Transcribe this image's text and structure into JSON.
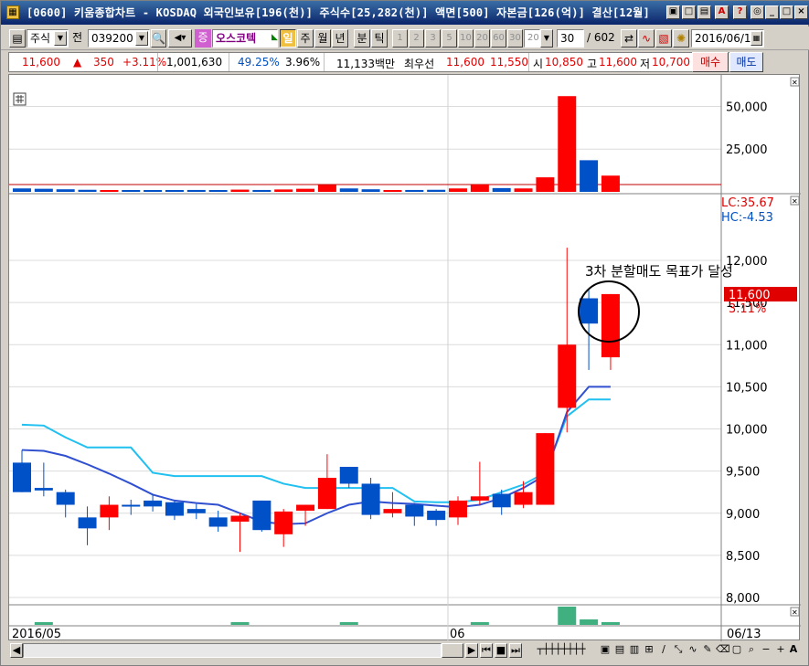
{
  "window": {
    "title": "[0600] 키움종합차트 - KOSDAQ 외국인보유[196(천)] 주식수[25,282(천)] 액면[500] 자본금[126(억)] 결산[12월]",
    "title_buttons": [
      "restore-small",
      "window",
      "tile",
      "print",
      "alert",
      "help",
      "find",
      "min",
      "max",
      "close"
    ]
  },
  "toolbar": {
    "market_type": "주식",
    "all_label": "전",
    "code": "039200",
    "stock_name": "오스코텍",
    "market_badge": "증",
    "periods": [
      "일",
      "주",
      "월",
      "년",
      "분",
      "틱"
    ],
    "active_period": "일",
    "intervals": [
      "1",
      "2",
      "3",
      "5",
      "10",
      "20",
      "60",
      "30",
      "20"
    ],
    "count": "30",
    "total": "/ 602",
    "date": "2016/06/1"
  },
  "quote": {
    "price": "11,600",
    "arrow": "▲",
    "change": "350",
    "change_pct": "+3.11%",
    "volume": "1,001,630",
    "vol_ratio": "49.25%",
    "turnover": "3.96%",
    "amount": "11,133백만",
    "best_label": "최우선",
    "best_ask": "11,600",
    "best_bid": "11,550",
    "open_label": "시",
    "open": "10,850",
    "high_label": "고",
    "high": "11,600",
    "low_label": "저",
    "low": "10,700",
    "buy": "매수",
    "sell": "매도"
  },
  "chart": {
    "volume_axis": [
      "50,000",
      "25,000"
    ],
    "price_axis": [
      "12,000",
      "11,500",
      "11,000",
      "10,500",
      "10,000",
      "9,500",
      "9,000",
      "8,500",
      "8,000"
    ],
    "lc_label": "LC:35.67",
    "hc_label": "HC:-4.53",
    "last_price_tag": "11,600",
    "last_pct_tag": "3.11%",
    "annotation": "3차 분할매도 목표가 달성",
    "x_labels": [
      "2016/05",
      "06"
    ],
    "end_date_label": "06/13"
  },
  "chart_data": {
    "type": "candlestick",
    "series_colors": {
      "up": "#ff0000",
      "down": "#0050c8",
      "ma_short": "#3050d0",
      "ma_long": "#20c0f0"
    },
    "ylim": [
      7950,
      12300
    ],
    "candles": [
      {
        "o": 9600,
        "h": 9750,
        "l": 9250,
        "c": 9250
      },
      {
        "o": 9300,
        "h": 9600,
        "l": 9200,
        "c": 9270
      },
      {
        "o": 9250,
        "h": 9280,
        "l": 8950,
        "c": 9100
      },
      {
        "o": 8950,
        "h": 9080,
        "l": 8620,
        "c": 8820
      },
      {
        "o": 8950,
        "h": 9200,
        "l": 8800,
        "c": 9100
      },
      {
        "o": 9100,
        "h": 9160,
        "l": 8980,
        "c": 9090
      },
      {
        "o": 9150,
        "h": 9220,
        "l": 9020,
        "c": 9080
      },
      {
        "o": 9130,
        "h": 9150,
        "l": 8920,
        "c": 8970
      },
      {
        "o": 9050,
        "h": 9110,
        "l": 8930,
        "c": 9000
      },
      {
        "o": 8950,
        "h": 9030,
        "l": 8780,
        "c": 8840
      },
      {
        "o": 8900,
        "h": 9000,
        "l": 8540,
        "c": 8970
      },
      {
        "o": 9150,
        "h": 9150,
        "l": 8780,
        "c": 8800
      },
      {
        "o": 8750,
        "h": 9050,
        "l": 8600,
        "c": 9020
      },
      {
        "o": 9030,
        "h": 9100,
        "l": 8850,
        "c": 9100
      },
      {
        "o": 9050,
        "h": 9700,
        "l": 9050,
        "c": 9420
      },
      {
        "o": 9550,
        "h": 9550,
        "l": 9300,
        "c": 9350
      },
      {
        "o": 9350,
        "h": 9420,
        "l": 8930,
        "c": 8980
      },
      {
        "o": 9000,
        "h": 9250,
        "l": 8950,
        "c": 9050
      },
      {
        "o": 9100,
        "h": 9120,
        "l": 8850,
        "c": 8960
      },
      {
        "o": 9030,
        "h": 9050,
        "l": 8850,
        "c": 8920
      },
      {
        "o": 8950,
        "h": 9200,
        "l": 8860,
        "c": 9150
      },
      {
        "o": 9150,
        "h": 9610,
        "l": 9100,
        "c": 9200
      },
      {
        "o": 9230,
        "h": 9280,
        "l": 8980,
        "c": 9070
      },
      {
        "o": 9100,
        "h": 9380,
        "l": 9060,
        "c": 9250
      },
      {
        "o": 9100,
        "h": 9950,
        "l": 9100,
        "c": 9950
      },
      {
        "o": 10250,
        "h": 12150,
        "l": 9960,
        "c": 11000
      },
      {
        "o": 11550,
        "h": 11650,
        "l": 10700,
        "c": 11250
      },
      {
        "o": 10850,
        "h": 11600,
        "l": 10700,
        "c": 11600
      }
    ],
    "ma_short": [
      9750,
      9740,
      9680,
      9580,
      9470,
      9350,
      9220,
      9150,
      9120,
      9100,
      9000,
      8900,
      8870,
      8880,
      9000,
      9100,
      9140,
      9120,
      9110,
      9090,
      9070,
      9100,
      9180,
      9300,
      9450,
      10200,
      10500,
      10500
    ],
    "ma_long": [
      10050,
      10040,
      9900,
      9780,
      9780,
      9780,
      9480,
      9440,
      9440,
      9440,
      9440,
      9440,
      9350,
      9300,
      9300,
      9300,
      9300,
      9300,
      9140,
      9130,
      9130,
      9160,
      9250,
      9340,
      9480,
      10150,
      10350,
      10350
    ],
    "volume": [
      2000,
      1800,
      1500,
      1200,
      1000,
      900,
      1000,
      900,
      1100,
      1000,
      1300,
      1100,
      1400,
      1800,
      4000,
      2000,
      1500,
      1000,
      1100,
      1200,
      2000,
      4200,
      2200,
      2000,
      8500,
      56000,
      18500,
      9500
    ],
    "volume_ylim": [
      0,
      62000
    ],
    "x_labels": [
      "2016/05",
      "06",
      "06/13"
    ]
  }
}
